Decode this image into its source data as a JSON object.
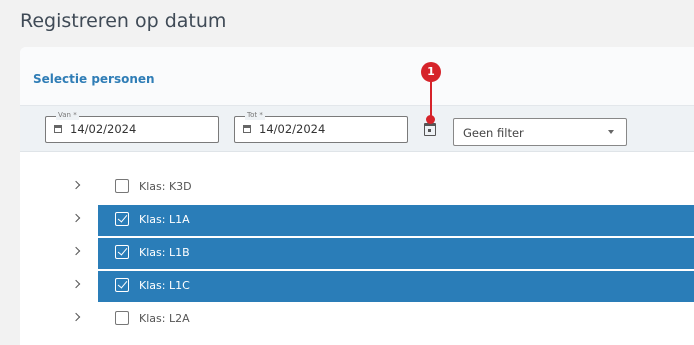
{
  "page": {
    "title": "Registreren op datum"
  },
  "card": {
    "title": "Selectie personen"
  },
  "filters": {
    "van": {
      "label": "Van *",
      "value": "14/02/2024"
    },
    "tot": {
      "label": "Tot *",
      "value": "14/02/2024"
    },
    "calendar_button_icon": "calendar-icon",
    "select": {
      "value": "Geen filter"
    }
  },
  "annotation": {
    "number": "1",
    "color": "#d6232a"
  },
  "groups": [
    {
      "label": "Klas: K3D",
      "selected": false
    },
    {
      "label": "Klas: L1A",
      "selected": true
    },
    {
      "label": "Klas: L1B",
      "selected": true
    },
    {
      "label": "Klas: L1C",
      "selected": true
    },
    {
      "label": "Klas: L2A",
      "selected": false
    }
  ],
  "colors": {
    "accent": "#2a7db8",
    "title": "#2f7db6"
  }
}
